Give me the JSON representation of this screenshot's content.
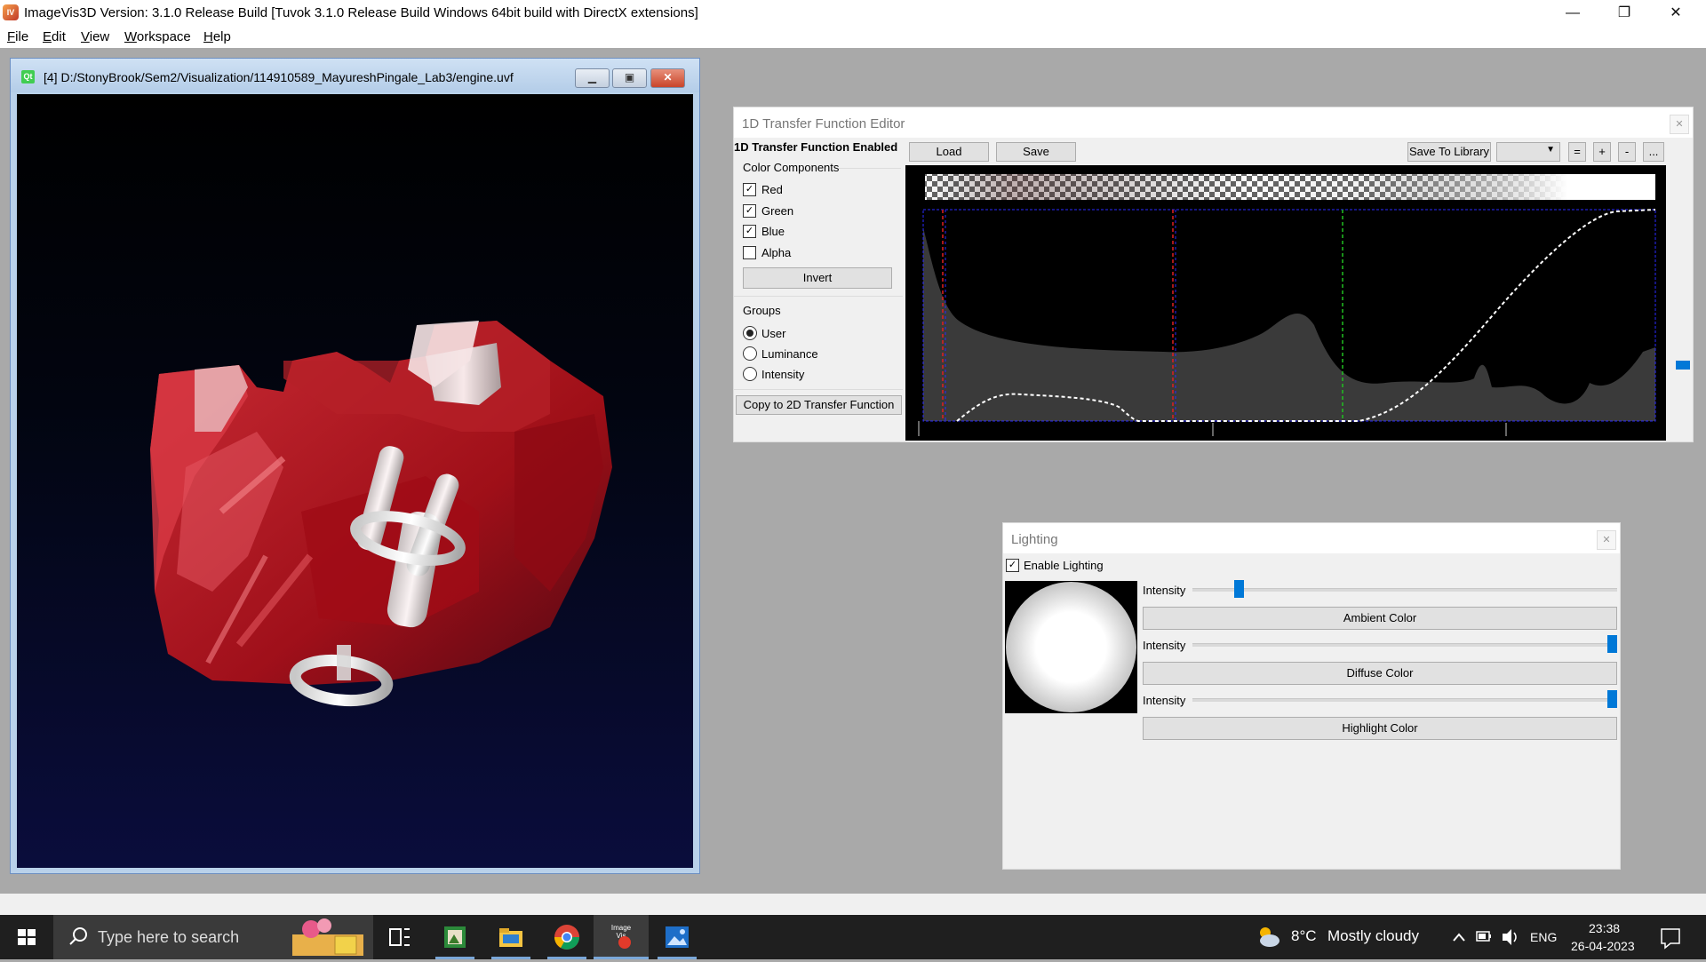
{
  "app": {
    "title": "ImageVis3D Version: 3.1.0 Release Build [Tuvok 3.1.0 Release Build Windows 64bit build with DirectX extensions]",
    "logo_text": "IV",
    "window_controls": {
      "minimize": "—",
      "maximize": "❐",
      "close": "✕"
    }
  },
  "menu": {
    "items": [
      {
        "mnemonic": "F",
        "rest": "ile"
      },
      {
        "mnemonic": "E",
        "rest": "dit"
      },
      {
        "mnemonic": "V",
        "rest": "iew"
      },
      {
        "mnemonic": "W",
        "rest": "orkspace"
      },
      {
        "mnemonic": "H",
        "rest": "elp"
      }
    ]
  },
  "render_window": {
    "icon_text": "Qt",
    "title": "[4] D:/StonyBrook/Sem2/Visualization/114910589_MayureshPingale_Lab3/engine.uvf",
    "controls": {
      "minimize": "▁",
      "maximize": "▣",
      "close": "✕"
    }
  },
  "tf_editor": {
    "title": "1D Transfer Function Editor",
    "close": "✕",
    "enabled_label": "1D Transfer Function Enabled",
    "color_components_label": "Color Components",
    "components": [
      {
        "label": "Red",
        "checked": true,
        "mark": "✓"
      },
      {
        "label": "Green",
        "checked": true,
        "mark": "✓"
      },
      {
        "label": "Blue",
        "checked": true,
        "mark": "✓"
      },
      {
        "label": "Alpha",
        "checked": false,
        "mark": ""
      }
    ],
    "invert_label": "Invert",
    "groups_label": "Groups",
    "groups": [
      {
        "label": "User",
        "selected": true
      },
      {
        "label": "Luminance",
        "selected": false
      },
      {
        "label": "Intensity",
        "selected": false
      }
    ],
    "copy_2d_label": "Copy to 2D Transfer Function",
    "load_label": "Load",
    "save_label": "Save",
    "save_library_label": "Save To Library",
    "library_value": "",
    "library_arrow": "▼",
    "small_buttons": [
      "=",
      "+",
      "-",
      "..."
    ]
  },
  "lighting": {
    "title": "Lighting",
    "close": "✕",
    "enable_label": "Enable Lighting",
    "enable_mark": "✓",
    "intensity_label": "Intensity",
    "ambient_intensity": 0.1,
    "diffuse_intensity": 1.0,
    "highlight_intensity": 1.0,
    "ambient_label": "Ambient Color",
    "diffuse_label": "Diffuse Color",
    "highlight_label": "Highlight Color"
  },
  "taskbar": {
    "search_placeholder": "Type here to search",
    "imagevis_icon_text": "Image Vis",
    "weather_temp": "8°C",
    "weather_desc": "Mostly cloudy",
    "language": "ENG",
    "time": "23:38",
    "date": "26-04-2023"
  },
  "colors": {
    "accent": "#0078d7",
    "volume_red": "#c0101a",
    "tf_red_line": "#e02020",
    "tf_green_line": "#20c020",
    "tf_blue_line": "#2a2aff"
  }
}
